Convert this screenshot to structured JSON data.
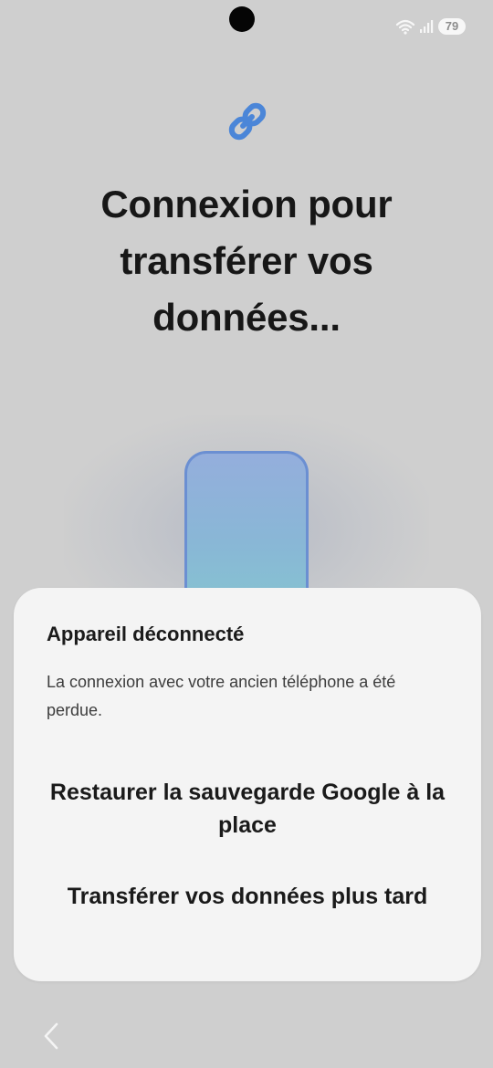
{
  "status_bar": {
    "battery_level": "79",
    "icons": [
      "wifi-icon",
      "signal-icon",
      "battery-icon"
    ]
  },
  "main": {
    "icon": "link-icon",
    "title": "Connexion pour transférer vos données..."
  },
  "dialog": {
    "title": "Appareil déconnecté",
    "message": "La connexion avec votre ancien téléphone a été perdue.",
    "restore_button_label": "Restaurer la sauvegarde Google à la place",
    "later_button_label": "Transférer vos données plus tard"
  },
  "navigation": {
    "back_icon": "chevron-left-icon"
  },
  "colors": {
    "background": "#cfcfcf",
    "dialog_background": "#f4f4f4",
    "accent_blue": "#4b86d8",
    "phone_gradient_top": "#94aedc",
    "phone_gradient_bottom": "#85c4d0"
  }
}
